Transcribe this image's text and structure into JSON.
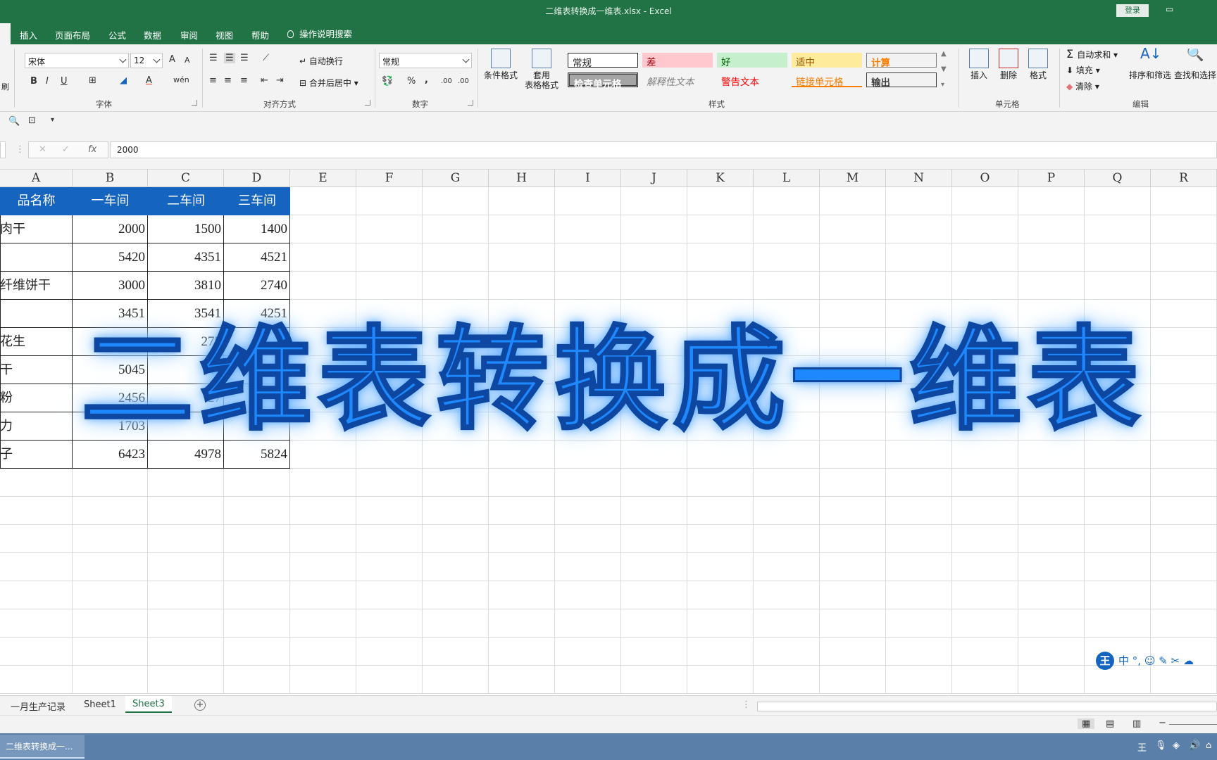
{
  "window": {
    "title": "二维表转换成一维表.xlsx  -  Excel",
    "login_label": "登录"
  },
  "ribbon_tabs": [
    "插入",
    "页面布局",
    "公式",
    "数据",
    "审阅",
    "视图",
    "帮助"
  ],
  "tell_me": "操作说明搜索",
  "font": {
    "name": "宋体",
    "size": "12",
    "grow": "A",
    "shrink": "A",
    "bold": "B",
    "italic": "I",
    "underline": "U",
    "font_color": "A",
    "wen": "wén"
  },
  "alignment": {
    "wrap_text": "自动换行",
    "merge_center": "合并后居中"
  },
  "number": {
    "format": "常规",
    "percent": "%",
    "comma": ",",
    "inc_decimal": ".00",
    "dec_decimal": ".00"
  },
  "big_buttons": {
    "conditional_format": "条件格式",
    "table_format_1": "套用",
    "table_format_2": "表格格式"
  },
  "styles": [
    {
      "label": "常规",
      "bg": "#ffffff",
      "fg": "#000000"
    },
    {
      "label": "差",
      "bg": "#ffc7ce",
      "fg": "#9c0006"
    },
    {
      "label": "好",
      "bg": "#c6efce",
      "fg": "#006100"
    },
    {
      "label": "适中",
      "bg": "#ffeb9c",
      "fg": "#9c5700"
    },
    {
      "label": "计算",
      "bg": "#f2f2f2",
      "fg": "#fa7d00"
    },
    {
      "label": "检查单元格",
      "bg": "#a5a5a5",
      "fg": "#ffffff"
    },
    {
      "label": "解释性文本",
      "bg": "#ffffff",
      "fg": "#7f7f7f"
    },
    {
      "label": "警告文本",
      "bg": "#ffffff",
      "fg": "#ff0000"
    },
    {
      "label": "链接单元格",
      "bg": "#ffffff",
      "fg": "#fa7d00"
    },
    {
      "label": "输出",
      "bg": "#f2f2f2",
      "fg": "#3f3f3f"
    }
  ],
  "cells_group": {
    "insert": "插入",
    "delete": "删除",
    "format": "格式"
  },
  "editing": {
    "autosum": "自动求和",
    "fill": "填充",
    "clear": "清除",
    "sort_filter": "排序和筛选",
    "find_select": "查找和选择"
  },
  "group_labels": {
    "font": "字体",
    "alignment": "对齐方式",
    "number": "数字",
    "styles": "样式",
    "cells": "单元格",
    "editing": "编辑"
  },
  "formula_bar": {
    "fx": "fx",
    "value": "2000"
  },
  "columns": [
    "A",
    "B",
    "C",
    "D",
    "E",
    "F",
    "G",
    "H",
    "I",
    "J",
    "K",
    "L",
    "M",
    "N",
    "O",
    "P",
    "Q",
    "R"
  ],
  "table": {
    "headers": [
      "品名称",
      "一车间",
      "二车间",
      "三车间"
    ],
    "rows": [
      [
        "肉干",
        "2000",
        "1500",
        "1400"
      ],
      [
        "",
        "5420",
        "4351",
        "4521"
      ],
      [
        "纤维饼干",
        "3000",
        "3810",
        "2740"
      ],
      [
        "",
        "3451",
        "3541",
        "4251"
      ],
      [
        "花生",
        "",
        "275",
        ""
      ],
      [
        "干",
        "5045",
        "47",
        ""
      ],
      [
        "粉",
        "2456",
        "27",
        ""
      ],
      [
        "力",
        "1703",
        "",
        ""
      ],
      [
        "子",
        "6423",
        "4978",
        "5824"
      ]
    ]
  },
  "overlay_title": "二维表转换成一维表",
  "sheets": [
    "一月生产记录",
    "Sheet1",
    "Sheet3"
  ],
  "active_sheet": "Sheet3",
  "ime": {
    "logo": "王",
    "mode": "中"
  },
  "taskbar": {
    "app_label": "二维表转换成一..."
  }
}
